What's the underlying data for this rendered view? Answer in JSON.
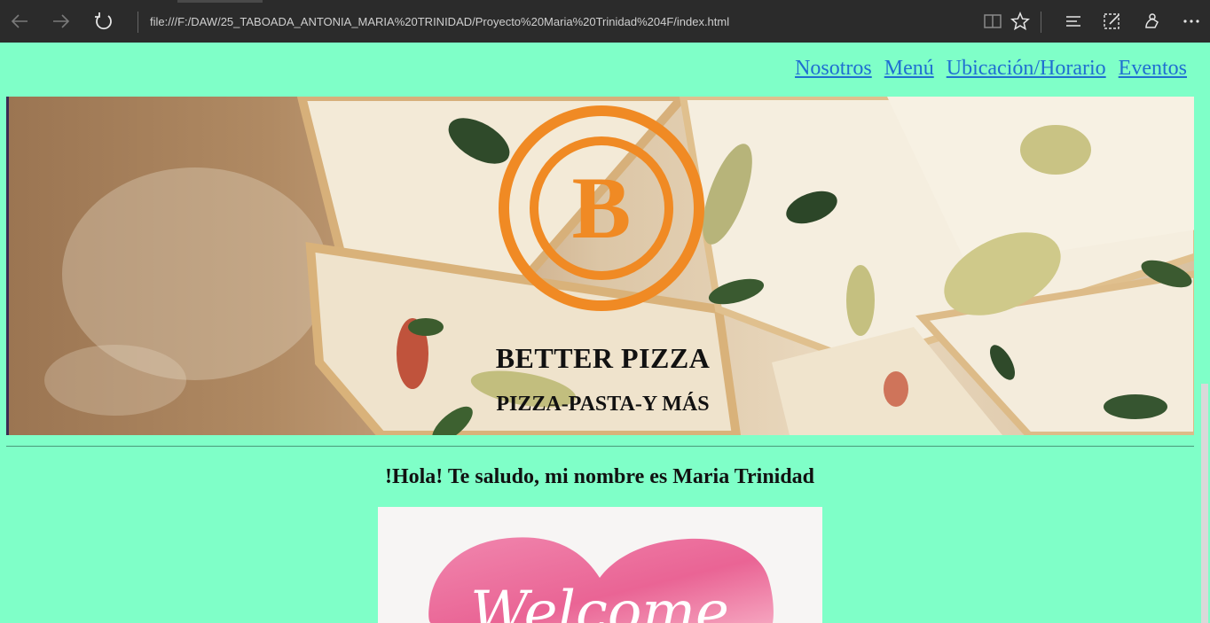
{
  "browser": {
    "address": "file:///F:/DAW/25_TABOADA_ANTONIA_MARIA%20TRINIDAD/Proyecto%20Maria%20Trinidad%204F/index.html",
    "icons": [
      "back-icon",
      "forward-icon",
      "refresh-icon",
      "reading-view-icon",
      "favorite-star-icon",
      "hub-icon",
      "web-note-icon",
      "share-icon",
      "more-icon"
    ]
  },
  "nav": {
    "items": [
      "Nosotros",
      "Menú",
      "Ubicación/Horario",
      "Eventos"
    ]
  },
  "hero": {
    "logo_letter": "B",
    "title": "BETTER PIZZA",
    "subtitle": "PIZZA-PASTA-Y MÁS"
  },
  "greeting": "!Hola! Te saludo, mi nombre es Maria Trinidad",
  "welcome_image": {
    "script_text": "Welcome"
  },
  "colors": {
    "page_bg": "#7fffc8",
    "link": "#1f6fd1",
    "logo": "#f08a24",
    "chrome": "#2b2b2b"
  }
}
